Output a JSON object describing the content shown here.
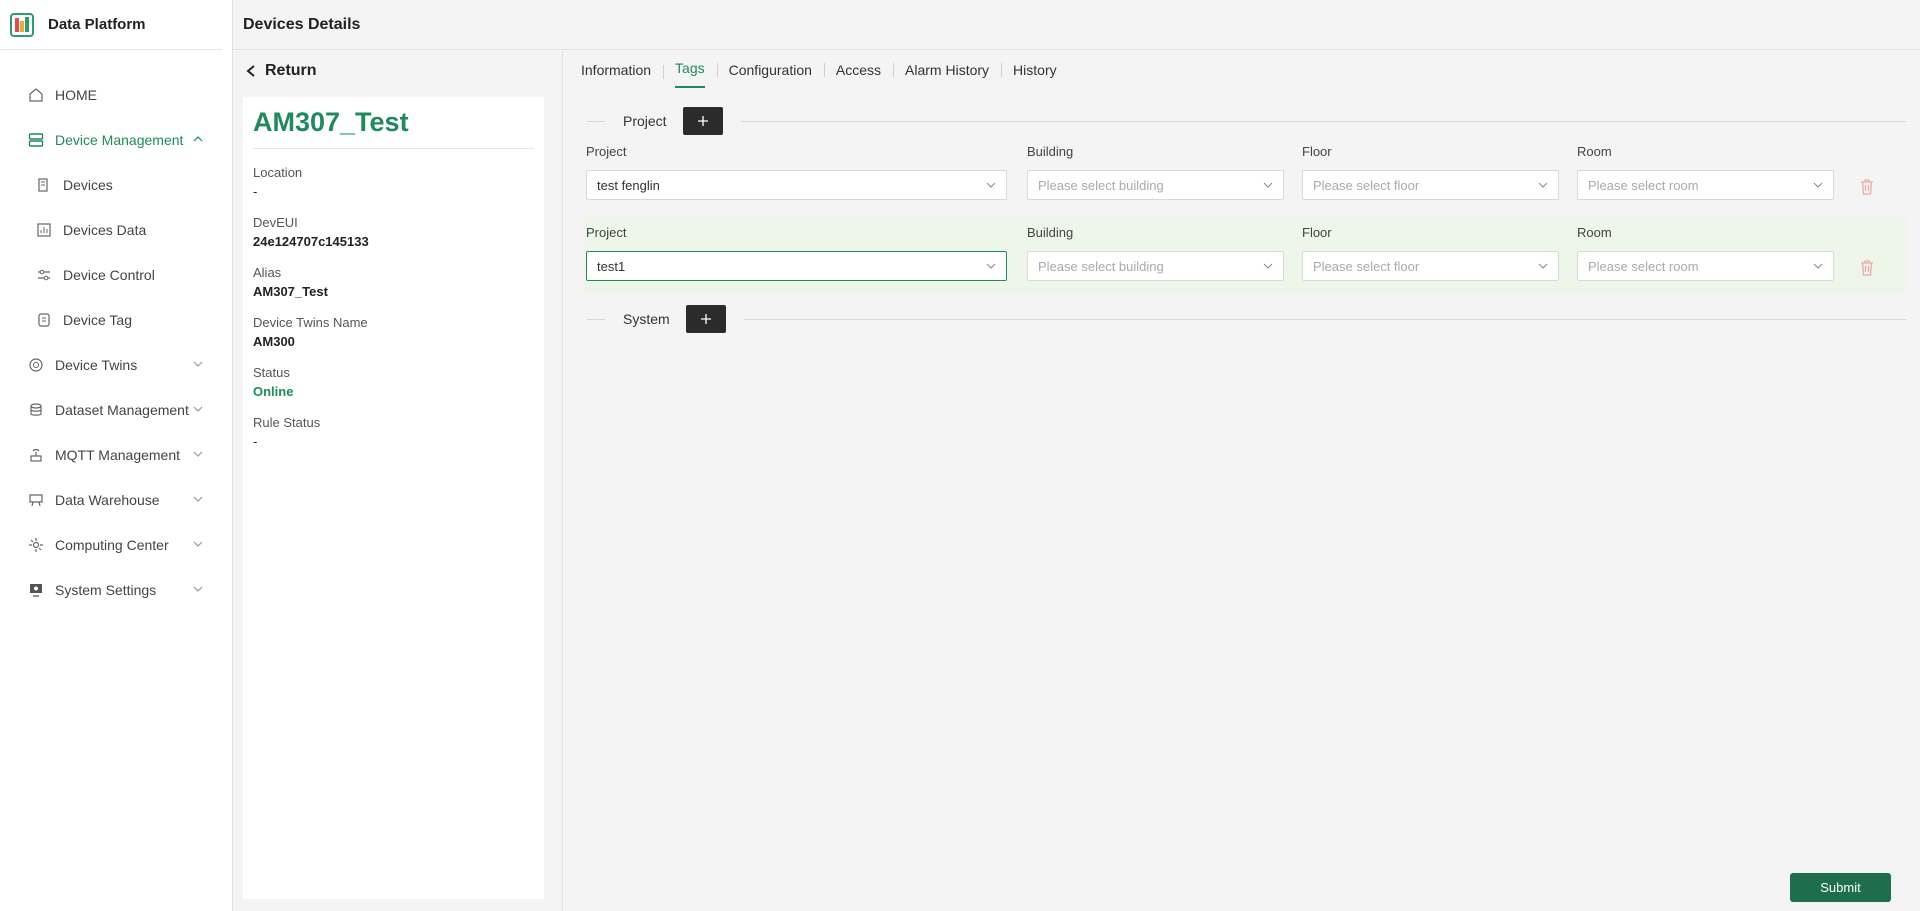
{
  "app": {
    "name": "Data Platform"
  },
  "sidebar": {
    "items": [
      {
        "label": "HOME",
        "icon": "home-icon"
      },
      {
        "label": "Device Management",
        "icon": "device-management-icon",
        "active": true,
        "expanded": true,
        "children": [
          {
            "label": "Devices",
            "icon": "devices-icon"
          },
          {
            "label": "Devices Data",
            "icon": "devices-data-icon"
          },
          {
            "label": "Device Control",
            "icon": "device-control-icon"
          },
          {
            "label": "Device Tag",
            "icon": "device-tag-icon"
          }
        ]
      },
      {
        "label": "Device Twins",
        "icon": "device-twins-icon"
      },
      {
        "label": "Dataset Management",
        "icon": "dataset-icon"
      },
      {
        "label": "MQTT Management",
        "icon": "mqtt-icon"
      },
      {
        "label": "Data Warehouse",
        "icon": "warehouse-icon"
      },
      {
        "label": "Computing Center",
        "icon": "computing-icon"
      },
      {
        "label": "System Settings",
        "icon": "settings-icon"
      }
    ]
  },
  "header": {
    "title": "Devices Details"
  },
  "info": {
    "return_label": "Return",
    "device_name": "AM307_Test",
    "fields": [
      {
        "label": "Location",
        "value": "-"
      },
      {
        "label": "DevEUI",
        "value": "24e124707c145133"
      },
      {
        "label": "Alias",
        "value": "AM307_Test"
      },
      {
        "label": "Device Twins Name",
        "value": "AM300"
      },
      {
        "label": "Status",
        "value": "Online"
      },
      {
        "label": "Rule Status",
        "value": "-"
      }
    ]
  },
  "tabs": [
    "Information",
    "Tags",
    "Configuration",
    "Access",
    "Alarm History",
    "History"
  ],
  "active_tab": "Tags",
  "tags": {
    "project_section_label": "Project",
    "system_section_label": "System",
    "rows": [
      {
        "project_label": "Project",
        "project_value": "test fenglin",
        "building_label": "Building",
        "building_placeholder": "Please select building",
        "floor_label": "Floor",
        "floor_placeholder": "Please select floor",
        "room_label": "Room",
        "room_placeholder": "Please select room"
      },
      {
        "project_label": "Project",
        "project_value": "test1",
        "building_label": "Building",
        "building_placeholder": "Please select building",
        "floor_label": "Floor",
        "floor_placeholder": "Please select floor",
        "room_label": "Room",
        "room_placeholder": "Please select room"
      }
    ]
  },
  "submit_label": "Submit",
  "colors": {
    "accent": "#1f8a5b",
    "button_dark": "#2b2b2b",
    "submit": "#1f6e4b",
    "highlight_row": "#eef5e9"
  }
}
